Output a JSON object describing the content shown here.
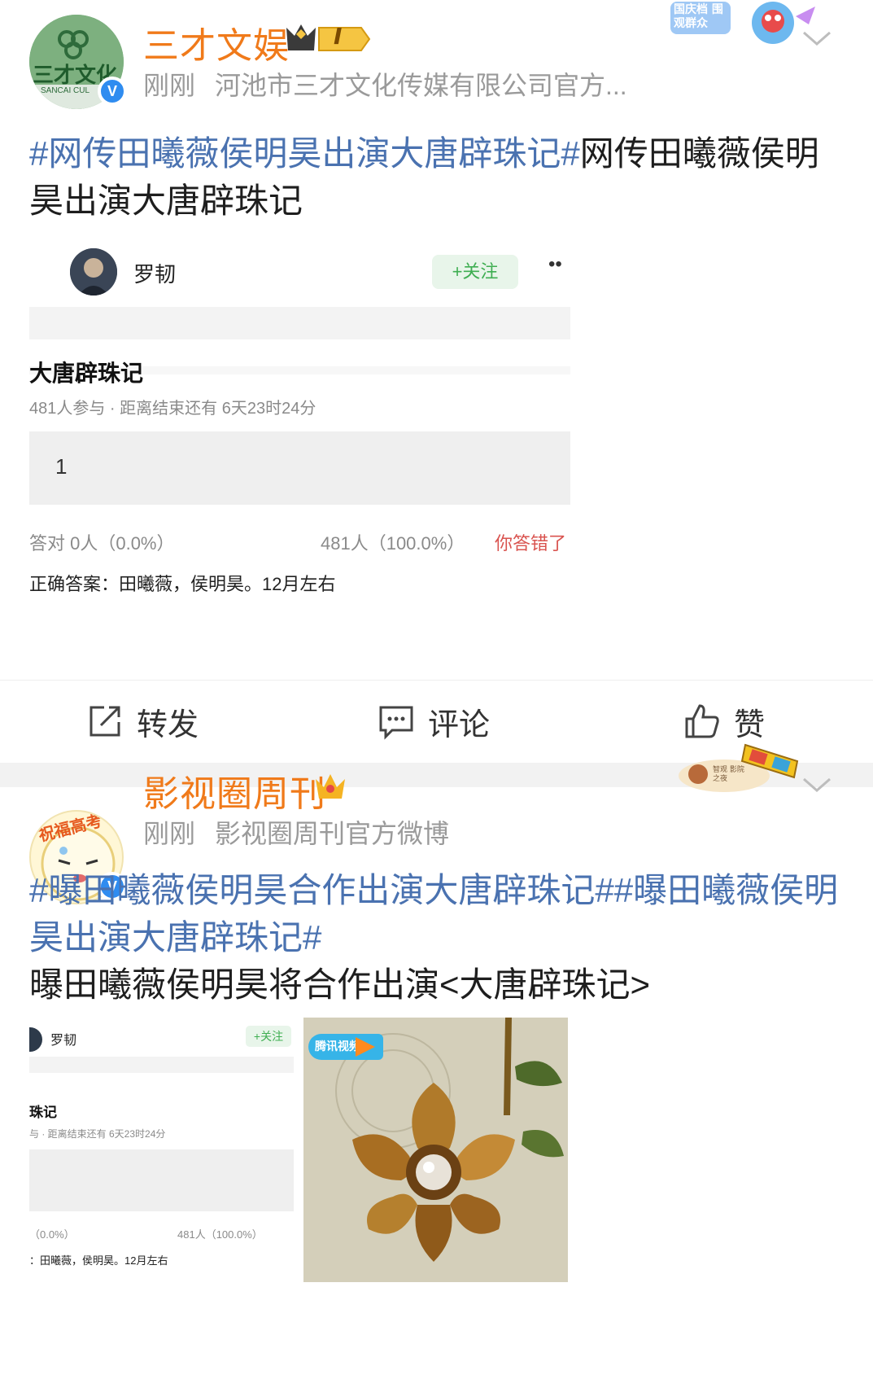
{
  "post1": {
    "username": "三才文娱",
    "rank_badge": "I",
    "time": "刚刚",
    "source": "河池市三才文化传媒有限公司官方...",
    "avatar_text": "三才文化",
    "avatar_subtext": "SANCAI CUL",
    "decor_text": "国庆档 围观群众",
    "content_tag": "#网传田曦薇侯明昊出演大唐辟珠记#",
    "content_text": "网传田曦薇侯明昊出演大唐辟珠记",
    "embedded": {
      "author": "罗韧",
      "follow_label": "+关注",
      "more_label": "••",
      "poll_title": "大唐辟珠记",
      "poll_meta": "481人参与 · 距离结束还有 6天23时24分",
      "option_label": "1",
      "correct_stat": "答对 0人（0.0%）",
      "wrong_stat": "481人（100.0%）",
      "wrong_note": "你答错了",
      "answer_line": "正确答案：田曦薇，侯明昊。12月左右"
    },
    "actions": {
      "repost": "转发",
      "comment": "评论",
      "like": "赞"
    }
  },
  "post2": {
    "username": "影视圈周刊",
    "time": "刚刚",
    "source": "影视圈周刊官方微博",
    "avatar_text": "祝福高考",
    "decor_text": "智观 影院之夜",
    "content_tag1": "#曝田曦薇侯明昊合作出演大唐辟珠记#",
    "content_tag2": "#曝田曦薇侯明昊出演大唐辟珠记#",
    "content_text": "曝田曦薇侯明昊将合作出演<大唐辟珠记>",
    "thumb1": {
      "author": "罗韧",
      "follow_label": "+关注",
      "poll_title": "珠记",
      "poll_meta": "与 · 距离结束还有 6天23时24分",
      "correct_stat": "（0.0%）",
      "wrong_stat": "481人（100.0%）",
      "answer_line": "：田曦薇，侯明昊。12月左右"
    },
    "thumb2": {
      "platform_label": "腾讯视频"
    }
  },
  "colors": {
    "username": "#f07a1a",
    "hashtag": "#4a72b0",
    "meta": "#9a9a9a",
    "wrong": "#d9534f",
    "follow_bg": "#e8f5ea",
    "follow_text": "#3fae52"
  }
}
